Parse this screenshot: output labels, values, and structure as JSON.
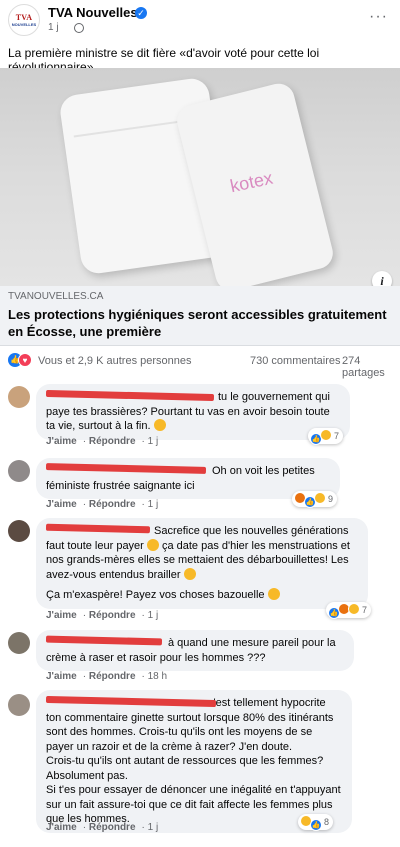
{
  "post": {
    "page_name": "TVA Nouvelles",
    "time": "1 j",
    "logo_top": "TVA",
    "logo_bottom": "NOUVELLES",
    "text": "La première ministre se dit fière «d'avoir voté pour cette loi révolutionnaire»",
    "image_brand": "kotex",
    "link_domain": "TVANOUVELLES.CA",
    "link_title": "Les protections hygiéniques seront accessibles gratuitement en Écosse, une première",
    "reactions_text": "Vous et 2,9 K autres personnes",
    "comments_count": "730 commentaires",
    "shares_count": "274 partages"
  },
  "actions": {
    "like": "J'aime",
    "reply": "Répondre"
  },
  "comments": [
    {
      "text": "tu le gouvernement qui paye tes brassières? Pourtant tu vas en avoir besoin toute ta vie, surtout à la fin.",
      "time": "1 j",
      "reaction_count": "7"
    },
    {
      "text": "Oh on voit les petites féministe frustrée saignante ici",
      "time": "1 j",
      "reaction_count": "9"
    },
    {
      "text": "Sacrefice que les nouvelles générations faut toute leur payer",
      "text_b": "ça date pas d'hier les menstruations et nos grands-mères elles se mettaient des débarbouillettes! Les avez-vous entendus brailler",
      "text_c": "Ça m'exaspère! Payez vos choses bazouelle",
      "time": "1 j",
      "reaction_count": "7"
    },
    {
      "text": "à quand une mesure pareil pour la crème à raser et rasoir pour les hommes ???",
      "time": "18 h"
    },
    {
      "text": "c'est tellement hypocrite ton commentaire ginette surtout lorsque 80% des itinérants sont des hommes. Crois-tu qu'ils ont les moyens de se payer un razoir et de la crème à razer? J'en doute.",
      "text_b": "Crois-tu qu'ils ont autant de ressources que les femmes? Absolument pas.",
      "text_c": "Si t'es pour essayer de dénoncer une inégalité en t'appuyant sur un fait assure-toi que ce dit fait affecte les femmes plus que les hommes.",
      "time": "1 j",
      "reaction_count": "8"
    }
  ]
}
